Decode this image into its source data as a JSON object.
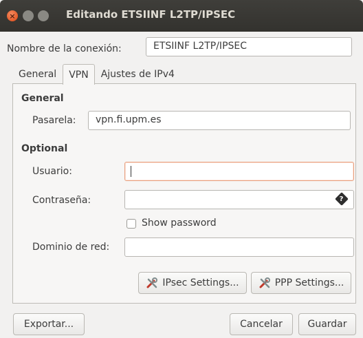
{
  "window": {
    "title": "Editando ETSIINF L2TP/IPSEC",
    "close_glyph": "×"
  },
  "connection": {
    "name_label": "Nombre de la conexión:",
    "name_value": "ETSIINF L2TP/IPSEC"
  },
  "tabs": [
    {
      "label": "General",
      "active": false
    },
    {
      "label": "VPN",
      "active": true
    },
    {
      "label": "Ajustes de IPv4",
      "active": false
    }
  ],
  "vpn": {
    "general_title": "General",
    "gateway_label": "Pasarela:",
    "gateway_value": "vpn.fi.upm.es",
    "optional_title": "Optional",
    "user_label": "Usuario:",
    "user_value": "",
    "password_label": "Contraseña:",
    "password_value": "",
    "password_icon": "?",
    "show_password_label": "Show password",
    "show_password_checked": false,
    "domain_label": "Dominio de red:",
    "domain_value": "",
    "ipsec_button": "IPsec Settings...",
    "ppp_button": "PPP Settings..."
  },
  "footer": {
    "export_button": "Exportar...",
    "cancel_button": "Cancelar",
    "save_button": "Guardar"
  },
  "colors": {
    "titlebar": "#3c3b37",
    "close_button": "#dd4814",
    "focus_border": "#e8a180",
    "background": "#f2f1f0"
  }
}
